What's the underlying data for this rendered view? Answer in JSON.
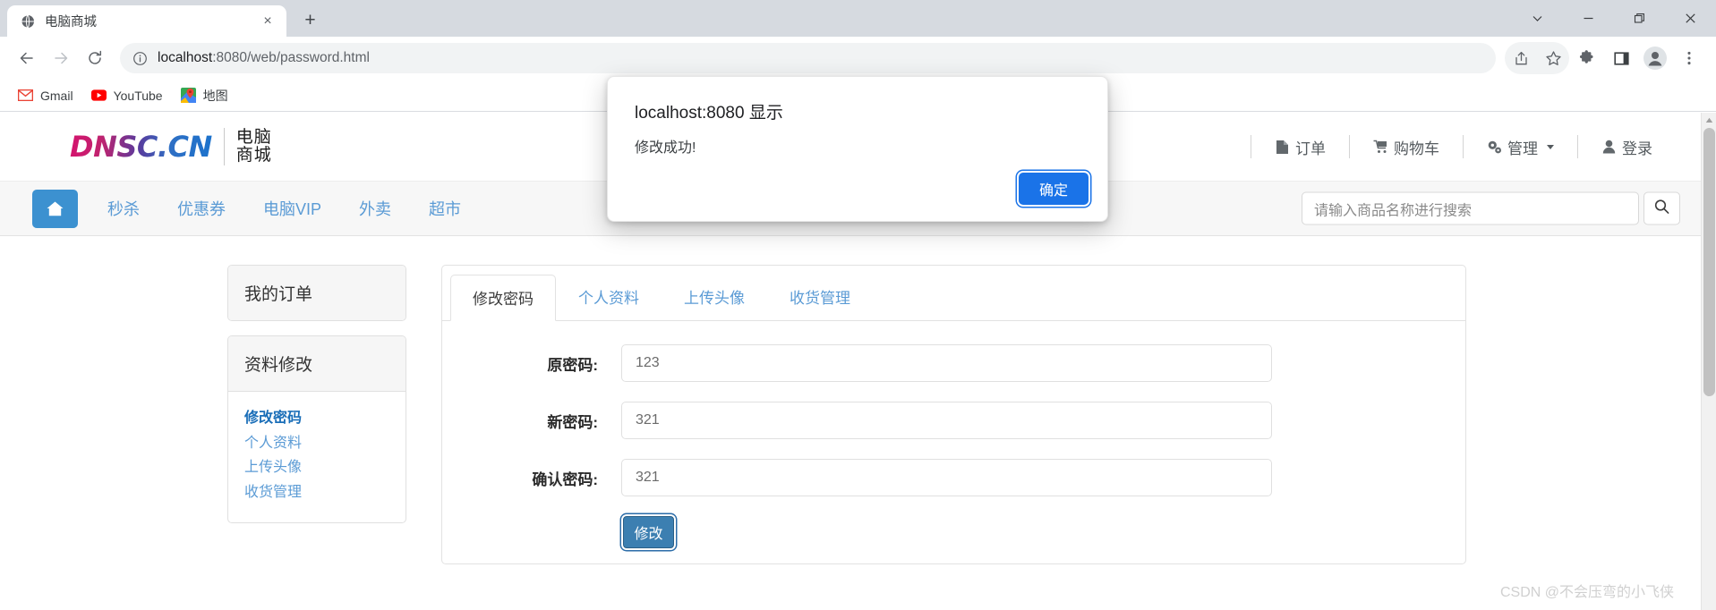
{
  "browser": {
    "tab": {
      "title": "电脑商城",
      "favicon": "globe-icon",
      "close": "×"
    },
    "newtab_label": "+",
    "window_controls": {
      "tab_search": "tab-search-icon",
      "minimize": "minimize-icon",
      "maximize": "maximize-icon",
      "close": "close-icon"
    },
    "toolbar": {
      "back": "back-arrow-icon",
      "forward": "forward-arrow-icon",
      "reload": "reload-icon",
      "site_info": "info-icon",
      "url_main": "localhost",
      "url_rest": ":8080/web/password.html",
      "share": "share-icon",
      "bookmark": "star-icon",
      "extensions": "puzzle-icon",
      "sidepanel": "side-panel-icon",
      "profile": "profile-avatar-icon",
      "menu": "three-dot-menu-icon"
    },
    "bookmarks": [
      {
        "label": "Gmail",
        "icon": "gmail-icon"
      },
      {
        "label": "YouTube",
        "icon": "youtube-icon"
      },
      {
        "label": "地图",
        "icon": "google-maps-icon"
      }
    ]
  },
  "dialog": {
    "title": "localhost:8080 显示",
    "message": "修改成功!",
    "ok_label": "确定"
  },
  "site": {
    "logo_text": "DNSC.CN",
    "logo_cn_line1": "电脑",
    "logo_cn_line2": "商城",
    "header_links": [
      {
        "label": "订单",
        "icon": "file-icon",
        "caret": false
      },
      {
        "label": "购物车",
        "icon": "cart-icon",
        "caret": false
      },
      {
        "label": "管理",
        "icon": "gears-icon",
        "caret": true
      },
      {
        "label": "登录",
        "icon": "user-icon",
        "caret": false
      }
    ],
    "nav": {
      "home_icon": "home-icon",
      "items": [
        "秒杀",
        "优惠券",
        "电脑VIP",
        "外卖",
        "超市"
      ]
    },
    "search": {
      "placeholder": "请输入商品名称进行搜索",
      "value": "",
      "button_icon": "search-icon"
    }
  },
  "sidebar": {
    "orders_panel_title": "我的订单",
    "profile_panel_title": "资料修改",
    "links": [
      {
        "label": "修改密码",
        "active": true
      },
      {
        "label": "个人资料",
        "active": false
      },
      {
        "label": "上传头像",
        "active": false
      },
      {
        "label": "收货管理",
        "active": false
      }
    ]
  },
  "main": {
    "tabs": [
      {
        "label": "修改密码",
        "active": true
      },
      {
        "label": "个人资料",
        "active": false
      },
      {
        "label": "上传头像",
        "active": false
      },
      {
        "label": "收货管理",
        "active": false
      }
    ],
    "form": {
      "fields": [
        {
          "label": "原密码:",
          "value": "123"
        },
        {
          "label": "新密码:",
          "value": "321"
        },
        {
          "label": "确认密码:",
          "value": "321"
        }
      ],
      "submit_label": "修改"
    }
  },
  "watermark": "CSDN @不会压弯的小飞侠"
}
